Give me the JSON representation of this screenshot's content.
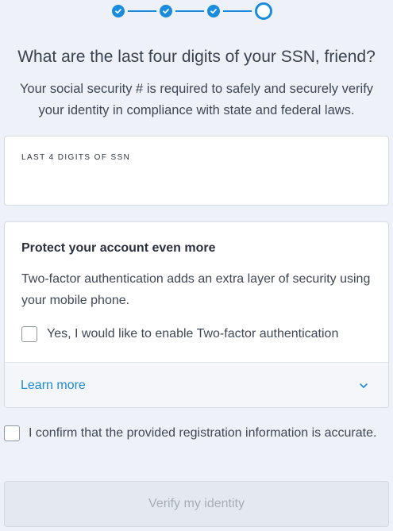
{
  "stepper": {
    "total_steps": 4,
    "completed_steps": 3,
    "current_step": 4,
    "accent_color": "#1a8ce0",
    "done_icon": "check-icon"
  },
  "header": {
    "title": "What are the last four digits of your SSN, friend?",
    "subtitle": "Your social security # is required to safely and securely verify your identity in compliance with state and federal laws."
  },
  "ssn_field": {
    "label": "LAST 4 DIGITS OF SSN",
    "value": ""
  },
  "protect": {
    "heading": "Protect your account even more",
    "description": "Two-factor authentication adds an extra layer of security using your mobile phone.",
    "checkbox_label": "Yes, I would like to enable Two-factor authentication",
    "checkbox_checked": false,
    "learn_more": "Learn more",
    "learn_more_icon": "chevron-down-icon",
    "link_color": "#1f8ad8"
  },
  "confirm": {
    "label": "I confirm that the provided registration information is accurate.",
    "checked": false
  },
  "verify_button": {
    "label": "Verify my identity",
    "disabled": true
  }
}
